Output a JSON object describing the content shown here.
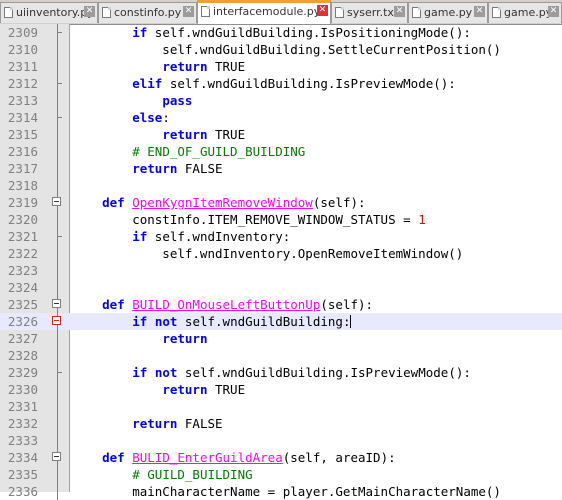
{
  "tabs": [
    {
      "label": "uiinventory.py",
      "active": false
    },
    {
      "label": "constinfo.py",
      "active": false
    },
    {
      "label": "interfacemodule.py",
      "active": true
    },
    {
      "label": "syserr.txt",
      "active": false
    },
    {
      "label": "game.py",
      "active": false
    },
    {
      "label": "game.py",
      "active": false
    }
  ],
  "tab_close_glyph": "✕",
  "colors": {
    "keyword": "#0000ff",
    "function_name": "#ff00ff",
    "number": "#ff0000",
    "comment": "#008000",
    "current_line": "#e8e8ff",
    "active_tab_accent": "#f0a030"
  },
  "lines": [
    {
      "num": "2309",
      "fold": "end",
      "segs": [
        {
          "t": "        "
        },
        {
          "t": "if",
          "c": "kw"
        },
        {
          "t": " self.wndGuildBuilding.IsPositioningMode():"
        }
      ]
    },
    {
      "num": "2310",
      "fold": "line",
      "segs": [
        {
          "t": "            self.wndGuildBuilding.SettleCurrentPosition()"
        }
      ]
    },
    {
      "num": "2311",
      "fold": "line",
      "segs": [
        {
          "t": "            "
        },
        {
          "t": "return",
          "c": "kw"
        },
        {
          "t": " TRUE"
        }
      ]
    },
    {
      "num": "2312",
      "fold": "end",
      "segs": [
        {
          "t": "        "
        },
        {
          "t": "elif",
          "c": "kw"
        },
        {
          "t": " self.wndGuildBuilding.IsPreviewMode():"
        }
      ]
    },
    {
      "num": "2313",
      "fold": "line",
      "segs": [
        {
          "t": "            "
        },
        {
          "t": "pass",
          "c": "kw"
        }
      ]
    },
    {
      "num": "2314",
      "fold": "end",
      "segs": [
        {
          "t": "        "
        },
        {
          "t": "else",
          "c": "kw"
        },
        {
          "t": ":"
        }
      ]
    },
    {
      "num": "2315",
      "fold": "line",
      "segs": [
        {
          "t": "            "
        },
        {
          "t": "return",
          "c": "kw"
        },
        {
          "t": " TRUE"
        }
      ]
    },
    {
      "num": "2316",
      "fold": "line",
      "segs": [
        {
          "t": "        "
        },
        {
          "t": "# END_OF_GUILD_BUILDING",
          "c": "cm"
        }
      ]
    },
    {
      "num": "2317",
      "fold": "line",
      "segs": [
        {
          "t": "        "
        },
        {
          "t": "return",
          "c": "kw"
        },
        {
          "t": " FALSE"
        }
      ]
    },
    {
      "num": "2318",
      "fold": "line",
      "segs": []
    },
    {
      "num": "2319",
      "fold": "box",
      "segs": [
        {
          "t": "    "
        },
        {
          "t": "def",
          "c": "kw"
        },
        {
          "t": " "
        },
        {
          "t": "OpenKygnItemRemoveWindow",
          "c": "df"
        },
        {
          "t": "(self):"
        }
      ]
    },
    {
      "num": "2320",
      "fold": "line",
      "segs": [
        {
          "t": "        constInfo.ITEM_REMOVE_WINDOW_STATUS = "
        },
        {
          "t": "1",
          "c": "num"
        }
      ]
    },
    {
      "num": "2321",
      "fold": "end",
      "segs": [
        {
          "t": "        "
        },
        {
          "t": "if",
          "c": "kw"
        },
        {
          "t": " self.wndInventory:"
        }
      ]
    },
    {
      "num": "2322",
      "fold": "line",
      "segs": [
        {
          "t": "            self.wndInventory.OpenRemoveItemWindow()"
        }
      ]
    },
    {
      "num": "2323",
      "fold": "line",
      "segs": []
    },
    {
      "num": "2324",
      "fold": "line",
      "segs": []
    },
    {
      "num": "2325",
      "fold": "box",
      "segs": [
        {
          "t": "    "
        },
        {
          "t": "def",
          "c": "kw"
        },
        {
          "t": " "
        },
        {
          "t": "BUILD_OnMouseLeftButtonUp",
          "c": "df"
        },
        {
          "t": "(self):"
        }
      ]
    },
    {
      "num": "2326",
      "fold": "boxred",
      "current": true,
      "segs": [
        {
          "t": "        "
        },
        {
          "t": "if",
          "c": "kw"
        },
        {
          "t": " "
        },
        {
          "t": "not",
          "c": "kw"
        },
        {
          "t": " self.wndGuildBuilding:"
        },
        {
          "caret": true
        }
      ]
    },
    {
      "num": "2327",
      "fold": "line",
      "segs": [
        {
          "t": "            "
        },
        {
          "t": "return",
          "c": "kw"
        }
      ]
    },
    {
      "num": "2328",
      "fold": "line",
      "segs": []
    },
    {
      "num": "2329",
      "fold": "end",
      "segs": [
        {
          "t": "        "
        },
        {
          "t": "if",
          "c": "kw"
        },
        {
          "t": " "
        },
        {
          "t": "not",
          "c": "kw"
        },
        {
          "t": " self.wndGuildBuilding.IsPreviewMode():"
        }
      ]
    },
    {
      "num": "2330",
      "fold": "line",
      "segs": [
        {
          "t": "            "
        },
        {
          "t": "return",
          "c": "kw"
        },
        {
          "t": " TRUE"
        }
      ]
    },
    {
      "num": "2331",
      "fold": "line",
      "segs": []
    },
    {
      "num": "2332",
      "fold": "line",
      "segs": [
        {
          "t": "        "
        },
        {
          "t": "return",
          "c": "kw"
        },
        {
          "t": " FALSE"
        }
      ]
    },
    {
      "num": "2333",
      "fold": "line",
      "segs": []
    },
    {
      "num": "2334",
      "fold": "box",
      "segs": [
        {
          "t": "    "
        },
        {
          "t": "def",
          "c": "kw"
        },
        {
          "t": " "
        },
        {
          "t": "BULID_EnterGuildArea",
          "c": "df"
        },
        {
          "t": "(self, areaID):"
        }
      ]
    },
    {
      "num": "2335",
      "fold": "line",
      "segs": [
        {
          "t": "        "
        },
        {
          "t": "# GUILD_BUILDING",
          "c": "cm"
        }
      ]
    },
    {
      "num": "2336",
      "fold": "line",
      "segs": [
        {
          "t": "        mainCharacterName = player.GetMainCharacterName()"
        }
      ]
    }
  ]
}
